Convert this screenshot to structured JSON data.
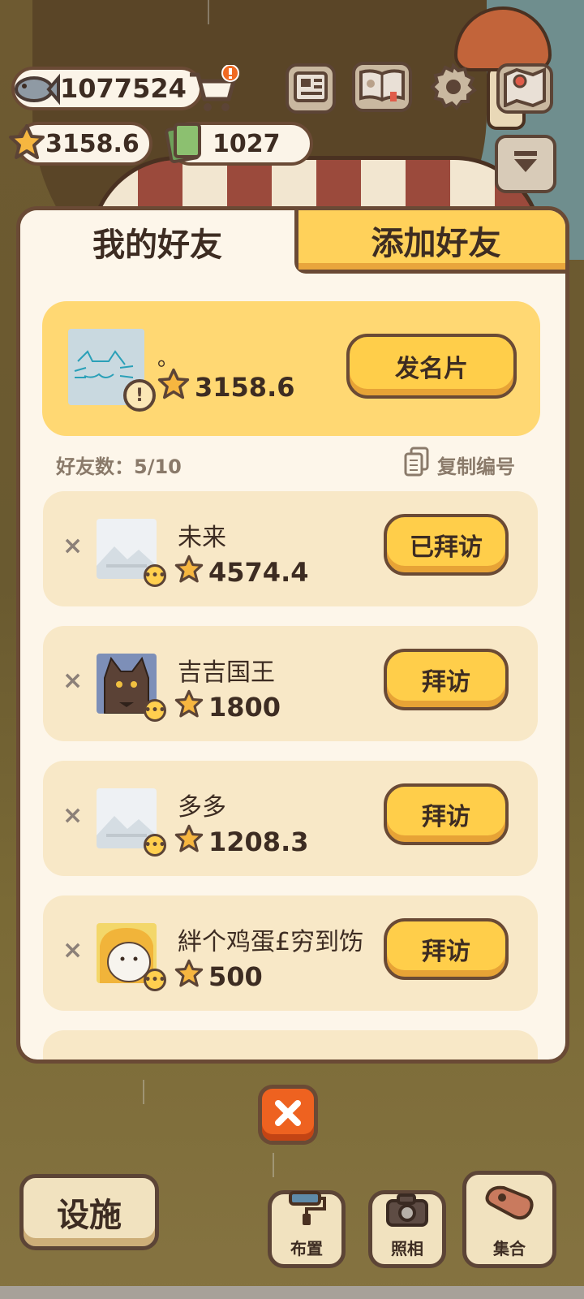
{
  "hud": {
    "fish_count": "1077524",
    "star_count": "3158.6",
    "ticket_count": "1027"
  },
  "tabs": {
    "my_friends": "我的好友",
    "add_friend": "添加好友"
  },
  "me": {
    "name": "。",
    "stars": "3158.6",
    "card_button": "发名片"
  },
  "friend_count": "好友数：5/10",
  "copy_id_label": "复制编号",
  "friends": [
    {
      "name": "未来",
      "stars": "4574.4",
      "button": "已拜访"
    },
    {
      "name": "吉吉国王",
      "stars": "1800",
      "button": "拜访"
    },
    {
      "name": "多多",
      "stars": "1208.3",
      "button": "拜访"
    },
    {
      "name": "絆个鸡蛋£穷到饬",
      "stars": "500",
      "button": "拜访"
    }
  ],
  "remove_glyph": "×",
  "bottom": {
    "facility": "设施",
    "layout": "布置",
    "photo": "照相",
    "gather": "集合"
  },
  "colors": {
    "accent_yellow": "#ffce4a",
    "panel_bg": "#fdf6ea",
    "outline_brown": "#6a4a35",
    "close_orange": "#ee6220"
  }
}
